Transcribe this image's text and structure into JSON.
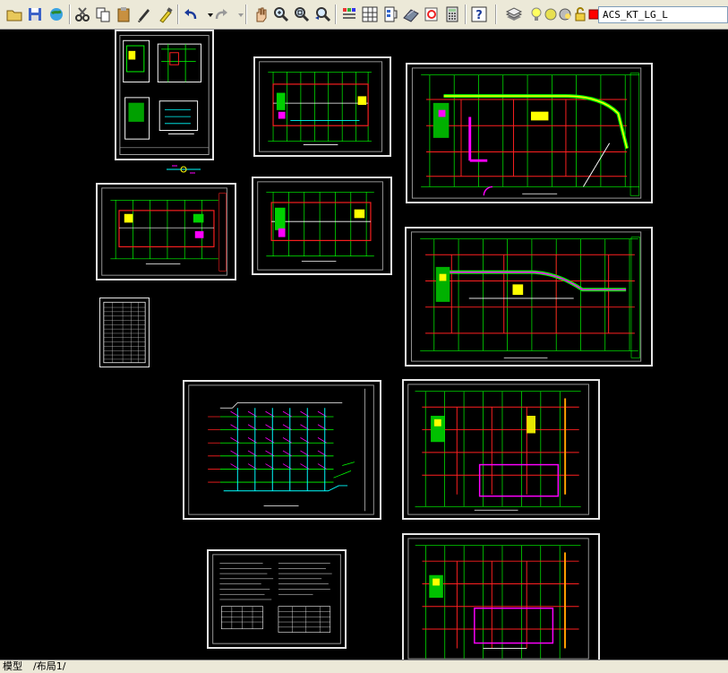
{
  "toolbar": {
    "icons": [
      "open-icon",
      "save-icon",
      "plot-icon",
      "cut-icon",
      "copy-icon",
      "paste-icon",
      "matchprop-icon",
      "brush-icon",
      "undo-icon",
      "redo-icon",
      "pan-icon",
      "zoom-realtime-icon",
      "zoom-window-icon",
      "zoom-previous-icon",
      "properties-icon",
      "design-center-icon",
      "tool-palettes-icon",
      "sheet-set-icon",
      "markup-icon",
      "calculator-icon",
      "help-icon",
      "layer-manager-icon",
      "layer-on-icon",
      "layer-freeze-icon",
      "layer-lock-icon",
      "layer-color-icon"
    ],
    "layer_name": "ACS_KT_LG_L"
  },
  "tabs": {
    "model": "模型",
    "layout1": "布局1"
  },
  "colors": {
    "sheet_border": "#e6e6e6",
    "plan_green": "#00ff00",
    "plan_red": "#ff2020",
    "plan_magenta": "#ff00ff",
    "plan_yellow": "#ffff00",
    "plan_cyan": "#00ffff"
  }
}
